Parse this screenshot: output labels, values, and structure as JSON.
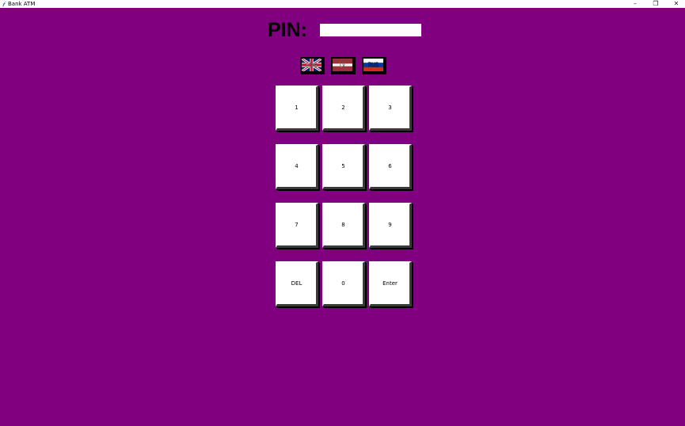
{
  "window": {
    "title": "Bank ATM",
    "background": "#800080",
    "controls": {
      "minimize": "–",
      "maximize": "❐",
      "close": "✕"
    }
  },
  "pin": {
    "label": "PIN:",
    "value": ""
  },
  "languages": [
    {
      "code": "ENG",
      "icon": "uk-flag-icon"
    },
    {
      "code": "LV",
      "icon": "latvia-flag-icon"
    },
    {
      "code": "RUS",
      "icon": "russia-flag-icon"
    }
  ],
  "keypad": {
    "keys": [
      "1",
      "2",
      "3",
      "4",
      "5",
      "6",
      "7",
      "8",
      "9",
      "DEL",
      "0",
      "Enter"
    ]
  }
}
